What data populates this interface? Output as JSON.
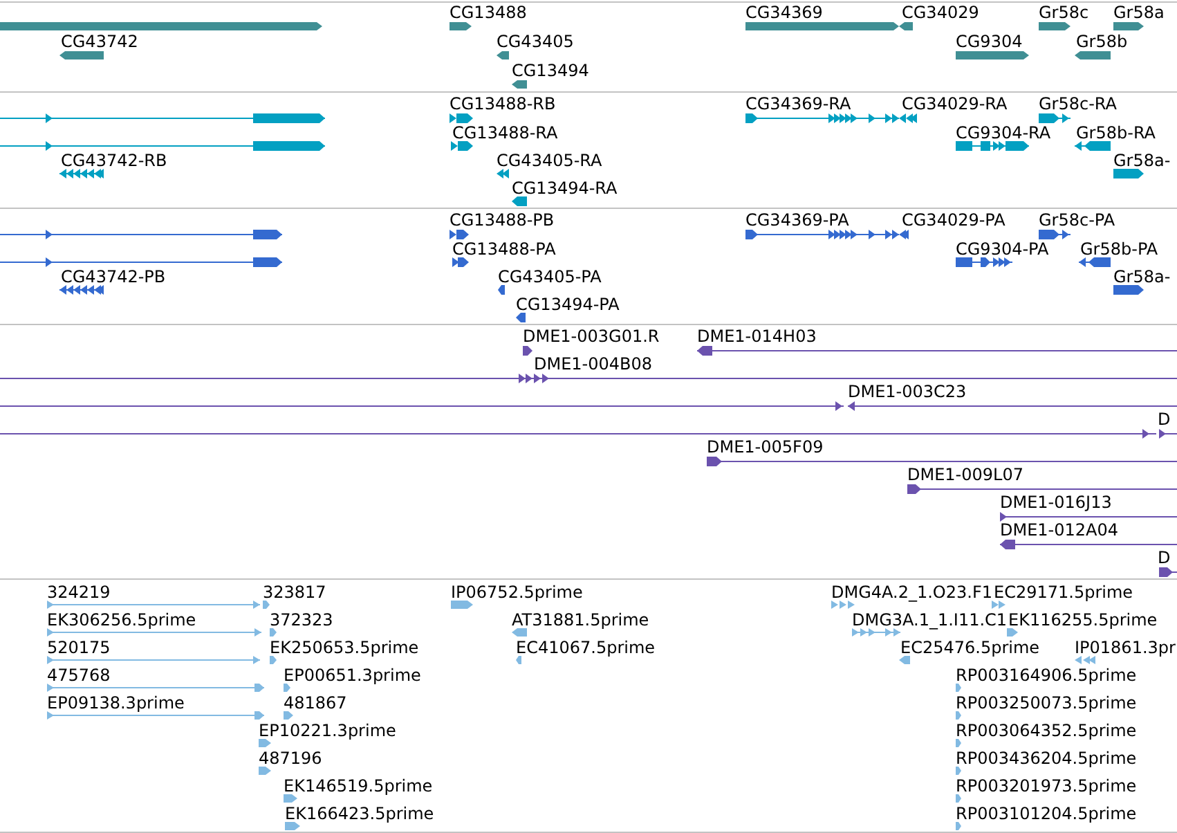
{
  "tracks": [
    {
      "color": "#408f94",
      "features": [
        {
          "reverse": false
        },
        {
          "label": "CG43742",
          "reverse": true
        },
        {
          "label": "CG13488",
          "reverse": false
        },
        {
          "label": "CG43405",
          "reverse": true
        },
        {
          "label": "CG13494",
          "reverse": true
        },
        {
          "label": "CG34369",
          "reverse": false
        },
        {
          "label": "CG34029",
          "reverse": true
        },
        {
          "label": "CG9304",
          "reverse": false
        },
        {
          "label": "Gr58c",
          "reverse": false
        },
        {
          "label": "Gr58b",
          "reverse": true
        },
        {
          "label": "Gr58a",
          "reverse": false
        }
      ]
    },
    {
      "color": "#03a0c2",
      "features": [
        {
          "reverse": false
        },
        {
          "reverse": false
        },
        {
          "label": "CG43742-RB",
          "reverse": true
        },
        {
          "label": "CG13488-RB",
          "reverse": false
        },
        {
          "label": "CG13488-RA",
          "reverse": false
        },
        {
          "label": "CG43405-RA",
          "reverse": true
        },
        {
          "label": "CG13494-RA",
          "reverse": true
        },
        {
          "label": "CG34369-RA",
          "reverse": false
        },
        {
          "label": "CG34029-RA",
          "reverse": true
        },
        {
          "label": "Gr58c-RA",
          "reverse": false
        },
        {
          "label": "CG9304-RA",
          "reverse": false
        },
        {
          "label": "Gr58b-RA",
          "reverse": true
        },
        {
          "label": "Gr58a-",
          "reverse": false
        }
      ]
    },
    {
      "color": "#346ad0",
      "features": [
        {
          "reverse": false
        },
        {
          "reverse": false
        },
        {
          "label": "CG43742-PB",
          "reverse": true
        },
        {
          "label": "CG13488-PB",
          "reverse": false
        },
        {
          "label": "CG13488-PA",
          "reverse": false
        },
        {
          "label": "CG43405-PA",
          "reverse": true
        },
        {
          "label": "CG13494-PA",
          "reverse": true
        },
        {
          "label": "CG34369-PA",
          "reverse": false
        },
        {
          "label": "CG34029-PA",
          "reverse": true
        },
        {
          "label": "Gr58c-PA",
          "reverse": false
        },
        {
          "label": "CG9304-PA",
          "reverse": false
        },
        {
          "label": "Gr58b-PA",
          "reverse": true
        },
        {
          "label": "Gr58a-",
          "reverse": false
        }
      ]
    },
    {
      "color": "#6b52ae",
      "features": [
        {
          "label": "DME1-003G01.R",
          "reverse": false
        },
        {
          "label": "DME1-014H03",
          "reverse": true
        },
        {
          "reverse": false
        },
        {
          "label": "DME1-004B08",
          "reverse": false
        },
        {
          "reverse": false
        },
        {
          "label": "DME1-003C23",
          "reverse": true
        },
        {
          "reverse": false
        },
        {
          "label": "D",
          "reverse": false
        },
        {
          "label": "DME1-005F09",
          "reverse": false
        },
        {
          "label": "DME1-009L07",
          "reverse": false
        },
        {
          "label": "DME1-016J13",
          "reverse": false
        },
        {
          "label": "DME1-012A04",
          "reverse": true
        },
        {
          "label": "D",
          "reverse": false
        }
      ]
    },
    {
      "color": "#82bae2",
      "features": [
        {
          "label": "324219",
          "reverse": false
        },
        {
          "label": "323817",
          "reverse": false
        },
        {
          "label": "EK306256.5prime",
          "reverse": false
        },
        {
          "label": "372323",
          "reverse": false
        },
        {
          "label": "520175",
          "reverse": false
        },
        {
          "label": "EK250653.5prime",
          "reverse": false
        },
        {
          "label": "475768",
          "reverse": false
        },
        {
          "label": "EP00651.3prime",
          "reverse": false
        },
        {
          "label": "EP09138.3prime",
          "reverse": false
        },
        {
          "label": "481867",
          "reverse": false
        },
        {
          "label": "EP10221.3prime",
          "reverse": false
        },
        {
          "label": "487196",
          "reverse": false
        },
        {
          "label": "EK146519.5prime",
          "reverse": false
        },
        {
          "label": "EK166423.5prime",
          "reverse": false
        },
        {
          "label": "IP06752.5prime",
          "reverse": false
        },
        {
          "label": "AT31881.5prime",
          "reverse": true
        },
        {
          "label": "EC41067.5prime",
          "reverse": true
        },
        {
          "label": "DMG4A.2_1.O23.F1",
          "reverse": false
        },
        {
          "label": "EC29171.5prime",
          "reverse": false
        },
        {
          "label": "DMG3A.1_1.I11.C1",
          "reverse": false
        },
        {
          "label": "EK116255.5prime",
          "reverse": false
        },
        {
          "label": "EC25476.5prime",
          "reverse": true
        },
        {
          "label": "IP01861.3pr",
          "reverse": true
        },
        {
          "label": "RP003164906.5prime",
          "reverse": false
        },
        {
          "label": "RP003250073.5prime",
          "reverse": false
        },
        {
          "label": "RP003064352.5prime",
          "reverse": false
        },
        {
          "label": "RP003436204.5prime",
          "reverse": false
        },
        {
          "label": "RP003201973.5prime",
          "reverse": false
        },
        {
          "label": "RP003101204.5prime",
          "reverse": false
        }
      ]
    }
  ]
}
